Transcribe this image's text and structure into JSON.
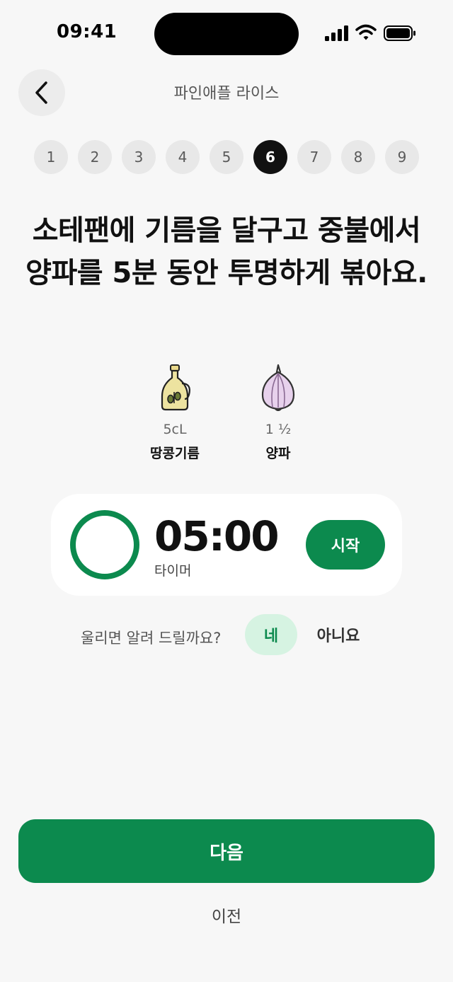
{
  "status_bar": {
    "time": "09:41"
  },
  "header": {
    "title": "파인애플 라이스"
  },
  "steps": [
    "1",
    "2",
    "3",
    "4",
    "5",
    "6",
    "7",
    "8",
    "9"
  ],
  "current_step": 6,
  "instruction": "소테팬에 기름을 달구고 중불에서 양파를 5분 동안 투명하게 볶아요.",
  "ingredients": [
    {
      "icon": "oil-bottle-icon",
      "quantity": "5cL",
      "name": "땅콩기름"
    },
    {
      "icon": "onion-icon",
      "quantity": "1 ½",
      "name": "양파"
    }
  ],
  "timer": {
    "value": "05:00",
    "label": "타이머",
    "start_label": "시작",
    "progress": 1.0
  },
  "notify": {
    "question": "울리면 알려 드릴까요?",
    "yes_label": "네",
    "no_label": "아니요"
  },
  "footer": {
    "next_label": "다음",
    "prev_label": "이전"
  },
  "colors": {
    "accent": "#0c8a4e",
    "accent_light": "#d6f3e2",
    "background": "#f7f7f7"
  }
}
